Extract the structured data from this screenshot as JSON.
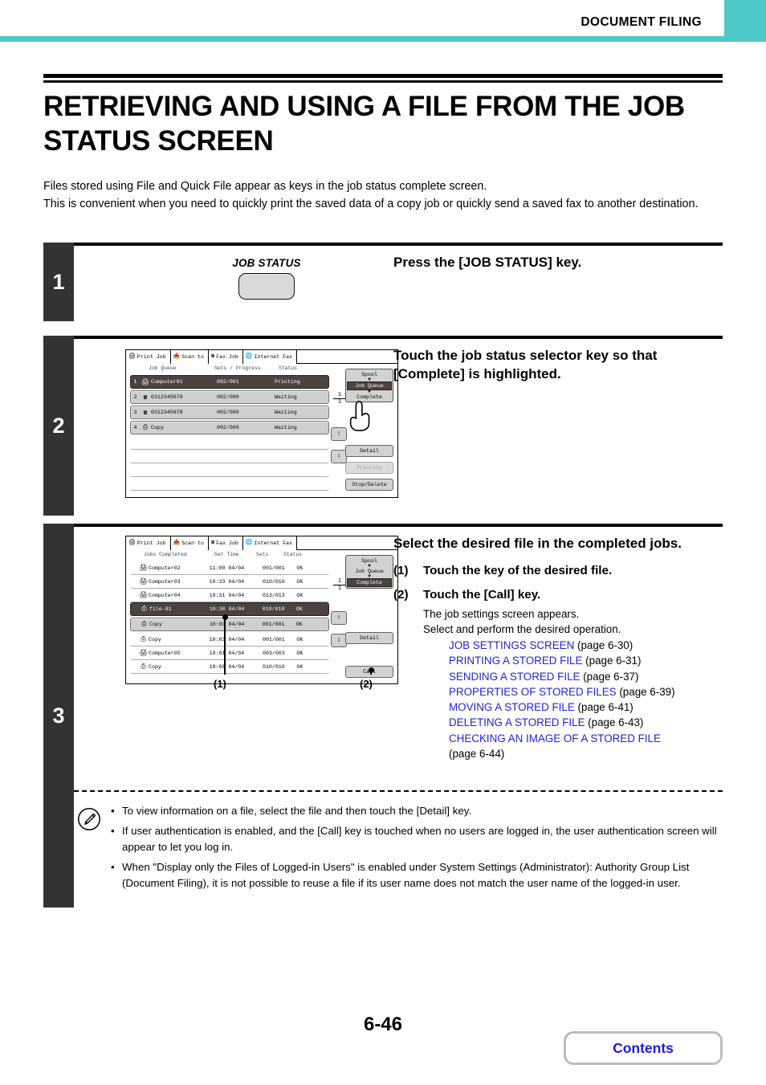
{
  "header": {
    "title": "DOCUMENT FILING",
    "accent_color": "#4ec9c9"
  },
  "page": {
    "title": "RETRIEVING AND USING A FILE FROM THE JOB STATUS SCREEN",
    "intro": "Files stored using File and Quick File appear as keys in the job status complete screen.\nThis is convenient when you need to quickly print the saved data of a copy job or quickly send a saved fax to another destination.",
    "number": "6-46"
  },
  "steps": [
    {
      "number": "1",
      "heading": "Press the [JOB STATUS] key.",
      "key_label": "JOB STATUS"
    },
    {
      "number": "2",
      "heading": "Touch the job status selector key so that [Complete] is highlighted."
    },
    {
      "number": "3",
      "heading": "Select the desired file in the completed jobs.",
      "substeps": [
        {
          "marker": "(1)",
          "text": "Touch the key of the desired file."
        },
        {
          "marker": "(2)",
          "text": "Touch the [Call] key."
        }
      ],
      "note_lines": [
        "The job settings screen appears.",
        "Select and perform the desired operation."
      ],
      "links": [
        {
          "text": "JOB SETTINGS SCREEN",
          "page": "(page 6-30)"
        },
        {
          "text": "PRINTING A STORED FILE",
          "page": "(page 6-31)"
        },
        {
          "text": "SENDING A STORED FILE",
          "page": "(page 6-37)"
        },
        {
          "text": "PROPERTIES OF STORED FILES",
          "page": "(page 6-39)"
        },
        {
          "text": "MOVING A STORED FILE",
          "page": "(page 6-41)"
        },
        {
          "text": "DELETING A STORED FILE",
          "page": "(page 6-43)"
        },
        {
          "text": "CHECKING AN IMAGE OF A STORED FILE",
          "page": "(page 6-44)"
        }
      ],
      "callouts": [
        "(1)",
        "(2)"
      ]
    }
  ],
  "screen2": {
    "tabs": [
      {
        "label": "Print Job",
        "icon": "printer-icon",
        "active": true
      },
      {
        "label": "Scan to",
        "icon": "scan-icon",
        "active": false
      },
      {
        "label": "Fax Job",
        "icon": "fax-icon",
        "active": false
      },
      {
        "label": "Internet Fax",
        "icon": "internet-fax-icon",
        "active": false
      }
    ],
    "columns": [
      "Job Queue",
      "Sets / Progress",
      "Status"
    ],
    "rows": [
      {
        "idx": "1",
        "icon": "printer-icon",
        "name": "Computer01",
        "mid": "002/001",
        "status": "Printing",
        "selected": true
      },
      {
        "idx": "2",
        "icon": "fax-icon",
        "name": "0312345678",
        "mid": "002/000",
        "status": "Waiting",
        "selected": false
      },
      {
        "idx": "3",
        "icon": "fax-icon",
        "name": "0312345678",
        "mid": "002/000",
        "status": "Waiting",
        "selected": false
      },
      {
        "idx": "4",
        "icon": "copy-icon",
        "name": "Copy",
        "mid": "002/000",
        "status": "Waiting",
        "selected": false
      }
    ],
    "page_current": "1",
    "page_total": "1",
    "selector": {
      "spool": "Spool",
      "job_queue": "Job Queue",
      "complete": "Complete",
      "highlighted": "Job Queue"
    },
    "buttons": [
      {
        "label": "Detail",
        "disabled": false
      },
      {
        "label": "Priority",
        "disabled": true
      },
      {
        "label": "Stop/Delete",
        "disabled": false
      }
    ]
  },
  "screen3": {
    "tabs": [
      {
        "label": "Print Job",
        "icon": "printer-icon",
        "active": true
      },
      {
        "label": "Scan to",
        "icon": "scan-icon",
        "active": false
      },
      {
        "label": "Fax Job",
        "icon": "fax-icon",
        "active": false
      },
      {
        "label": "Internet Fax",
        "icon": "internet-fax-icon",
        "active": false
      }
    ],
    "columns": [
      "Jobs Completed",
      "Set Time",
      "Sets",
      "Status"
    ],
    "rows": [
      {
        "icon": "printer-icon",
        "name": "Computer02",
        "time": "11:00 04/04",
        "sets": "001/001",
        "status": "OK",
        "style": "plain"
      },
      {
        "icon": "printer-icon",
        "name": "Computer03",
        "time": "10:33 04/04",
        "sets": "010/010",
        "status": "OK",
        "style": "plain"
      },
      {
        "icon": "printer-icon",
        "name": "Computer04",
        "time": "10:31 04/04",
        "sets": "013/013",
        "status": "OK",
        "style": "plain"
      },
      {
        "icon": "file-icon",
        "name": "file-01",
        "time": "10:30 04/04",
        "sets": "010/010",
        "status": "OK",
        "style": "sel"
      },
      {
        "icon": "copy-icon",
        "name": "Copy",
        "time": "10:03 04/04",
        "sets": "001/001",
        "status": "OK",
        "style": "key"
      },
      {
        "icon": "copy-icon",
        "name": "Copy",
        "time": "10:03 04/04",
        "sets": "001/001",
        "status": "OK",
        "style": "plain"
      },
      {
        "icon": "printer-icon",
        "name": "Computer05",
        "time": "10:01 04/04",
        "sets": "003/003",
        "status": "OK",
        "style": "plain"
      },
      {
        "icon": "copy-icon",
        "name": "Copy",
        "time": "10:00 04/04",
        "sets": "010/010",
        "status": "OK",
        "style": "plain"
      }
    ],
    "page_current": "1",
    "page_total": "1",
    "selector": {
      "spool": "Spool",
      "job_queue": "Job Queue",
      "complete": "Complete",
      "highlighted": "Complete"
    },
    "buttons": [
      {
        "label": "Detail",
        "disabled": false
      },
      {
        "label": "Call",
        "disabled": false
      }
    ]
  },
  "notes": [
    "To view information on a file, select the file and then touch the [Detail] key.",
    "If user authentication is enabled, and the [Call] key is touched when no users are logged in, the user authentication screen will appear to let you log in.",
    "When \"Display only the Files of Logged-in Users\" is enabled under System Settings (Administrator): Authority Group List (Document Filing), it is not possible to reuse a file if its user name does not match the user name of the logged-in user."
  ],
  "footer": {
    "contents_label": "Contents"
  }
}
